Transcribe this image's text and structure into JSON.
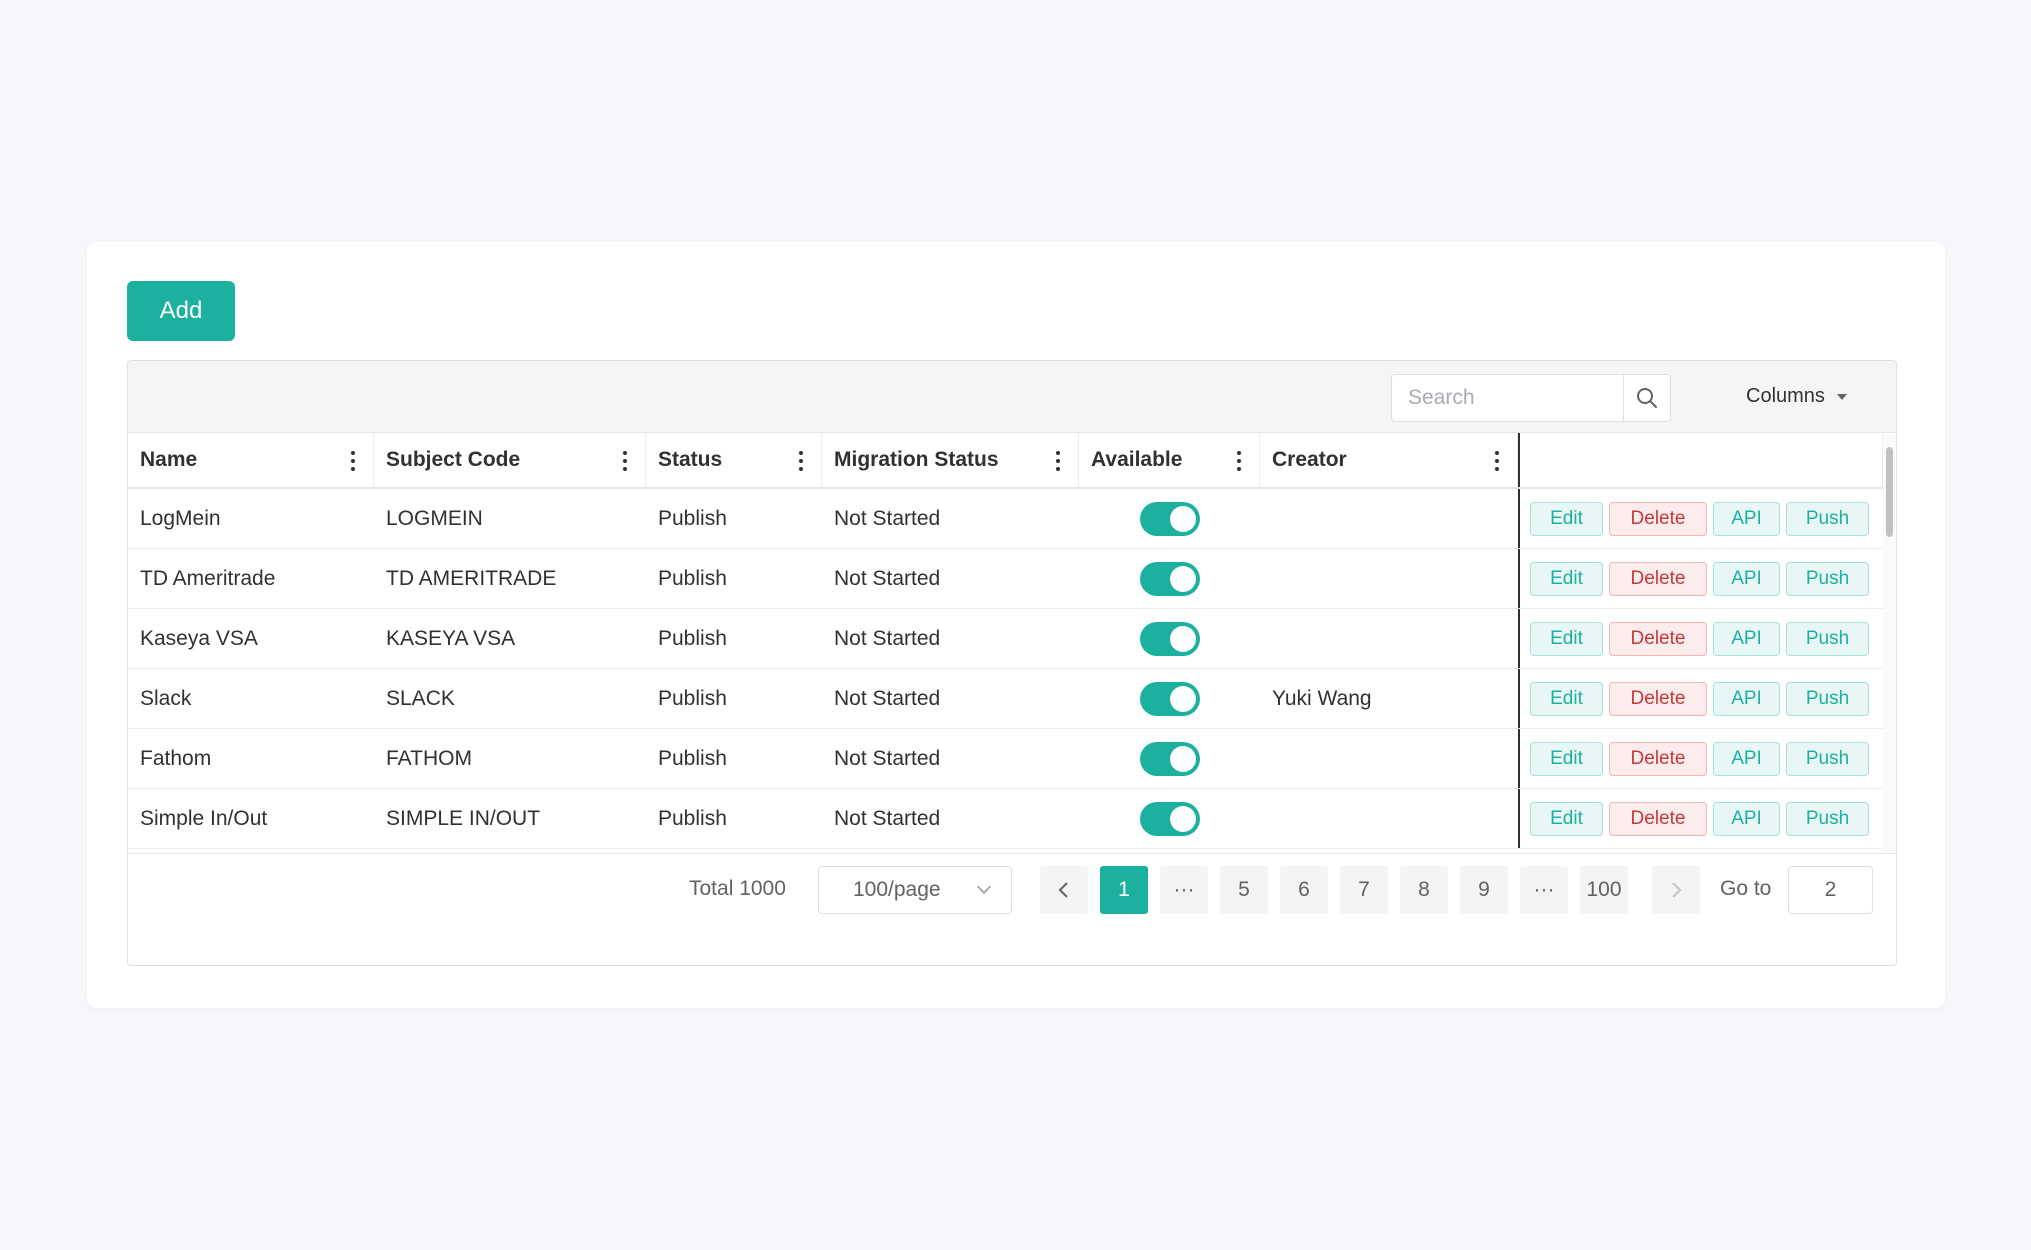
{
  "toolbar": {
    "add_label": "Add",
    "search_placeholder": "Search",
    "columns_label": "Columns"
  },
  "columns": [
    "Name",
    "Subject Code",
    "Status",
    "Migration Status",
    "Available",
    "Creator"
  ],
  "rows": [
    {
      "name": "LogMein",
      "code": "LOGMEIN",
      "status": "Publish",
      "migration": "Not Started",
      "available": true,
      "creator": ""
    },
    {
      "name": "TD Ameritrade",
      "code": "TD AMERITRADE",
      "status": "Publish",
      "migration": "Not Started",
      "available": true,
      "creator": ""
    },
    {
      "name": "Kaseya VSA",
      "code": "KASEYA VSA",
      "status": "Publish",
      "migration": "Not Started",
      "available": true,
      "creator": ""
    },
    {
      "name": "Slack",
      "code": "SLACK",
      "status": "Publish",
      "migration": "Not Started",
      "available": true,
      "creator": "Yuki Wang"
    },
    {
      "name": "Fathom",
      "code": "FATHOM",
      "status": "Publish",
      "migration": "Not Started",
      "available": true,
      "creator": ""
    },
    {
      "name": "Simple In/Out",
      "code": "SIMPLE IN/OUT",
      "status": "Publish",
      "migration": "Not Started",
      "available": true,
      "creator": ""
    }
  ],
  "row_actions": {
    "edit": "Edit",
    "delete": "Delete",
    "api": "API",
    "push": "Push"
  },
  "pagination": {
    "total_label": "Total 1000",
    "page_size": "100/page",
    "pages": [
      "1",
      "···",
      "5",
      "6",
      "7",
      "8",
      "9",
      "···",
      "100"
    ],
    "current_page": "1",
    "goto_label": "Go to",
    "goto_value": "2"
  },
  "colors": {
    "accent": "#1bb19e",
    "danger": "#c03a3a",
    "page_bg": "#f5f7fa"
  }
}
